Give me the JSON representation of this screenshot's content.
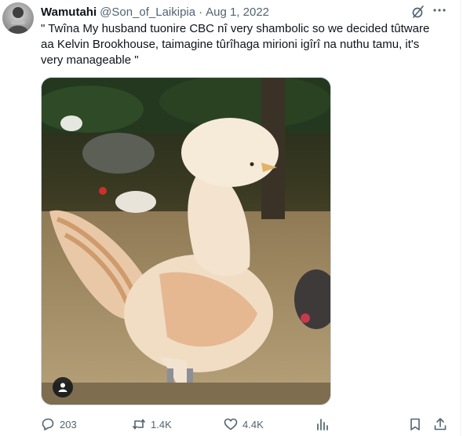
{
  "tweet": {
    "author": {
      "display_name": "Wamutahi",
      "handle": "@Son_of_Laikipia",
      "separator": "·",
      "date": "Aug 1, 2022"
    },
    "text": "\" Twîna My husband tuonire CBC nî very shambolic so we decided tûtware aa Kelvin Brookhouse, taimagine tûrîhaga mirioni igîrî na nuthu tamu, it's very manageable \"",
    "media": {
      "kind": "photo",
      "alt_badge_icon": "person-icon"
    },
    "actions": {
      "replies": "203",
      "reposts": "1.4K",
      "likes": "4.4K"
    },
    "icons": {
      "grok": "grok-slash-icon",
      "more": "more-dots-icon",
      "reply": "reply-icon",
      "repost": "repost-icon",
      "like": "heart-icon",
      "views": "views-chart-icon",
      "bookmark": "bookmark-icon",
      "share": "share-icon"
    },
    "colors": {
      "text_primary": "#0f1419",
      "text_secondary": "#536471",
      "border": "#cfd9de"
    }
  }
}
